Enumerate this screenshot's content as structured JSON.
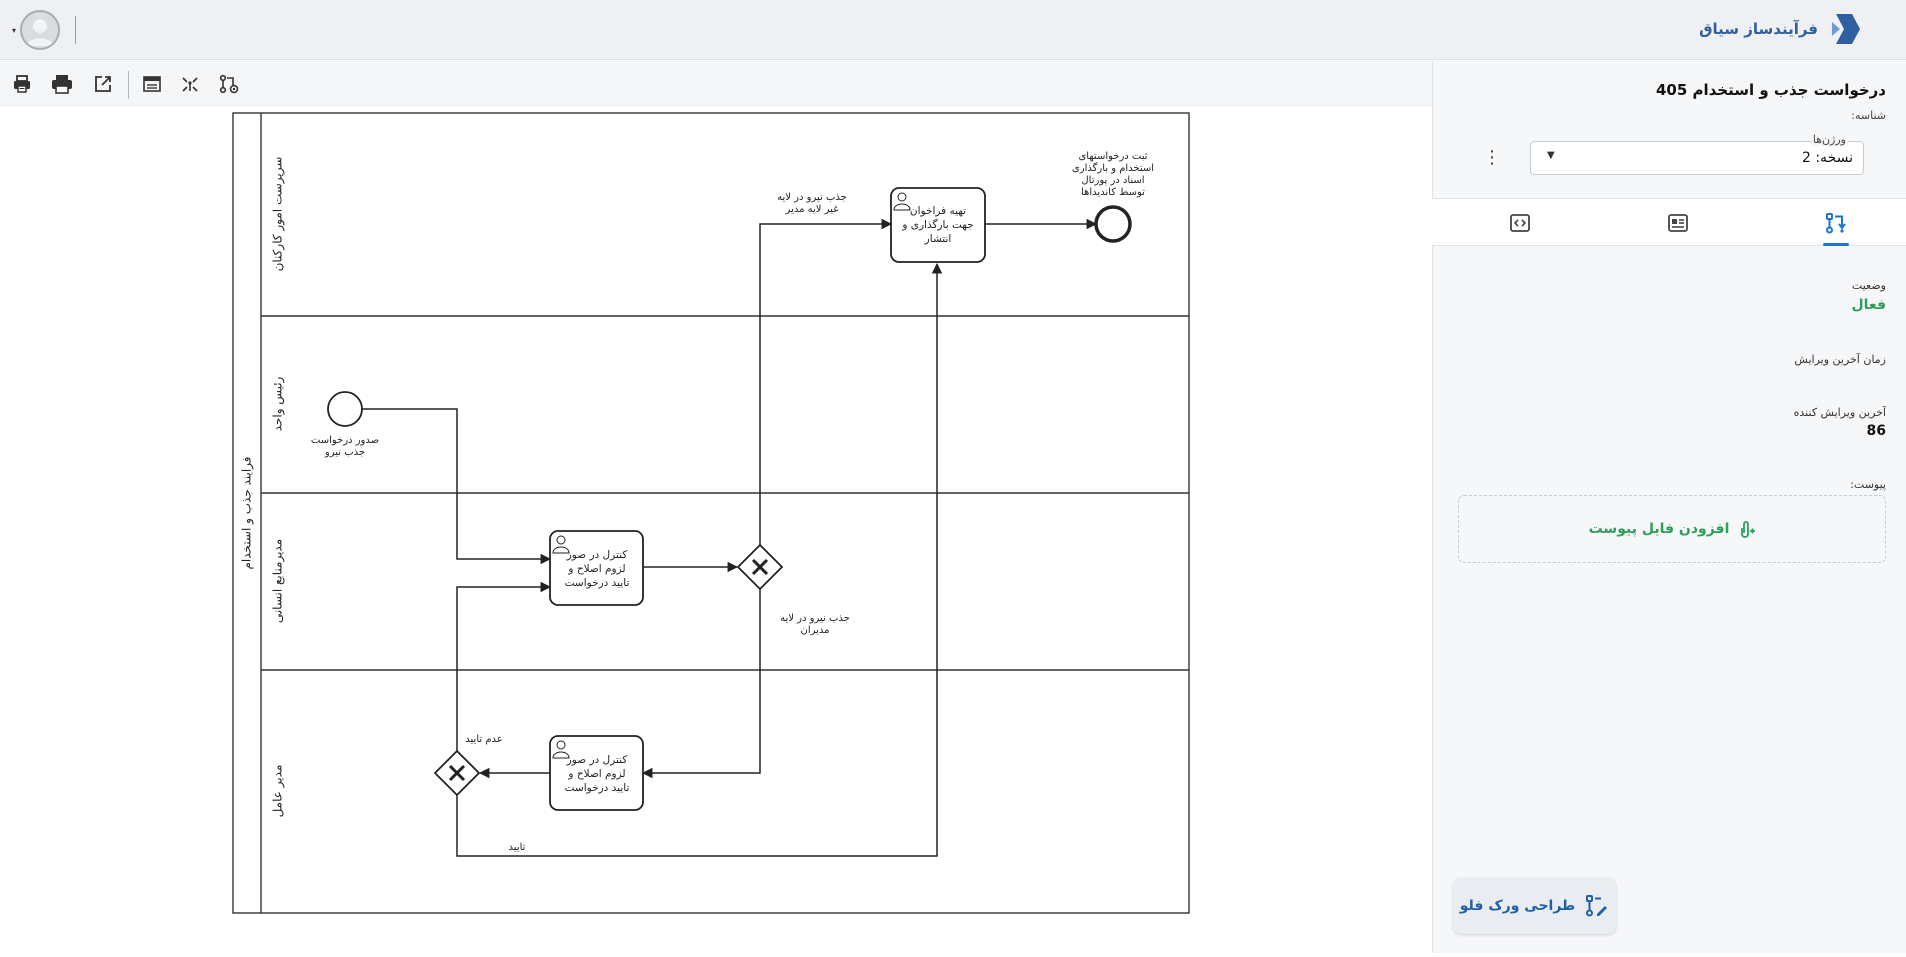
{
  "app": {
    "brand_name": "فرآیندساز سیاق",
    "brand_color": "#2f5f9e",
    "accent_color": "#1976d2",
    "active_color": "#2e9e5b"
  },
  "toolbar": {
    "icons": [
      "print-preview-icon",
      "print-icon",
      "open-external-icon",
      "table-view-icon",
      "split-icon",
      "process-settings-icon"
    ]
  },
  "panel": {
    "title": "درخواست جذب و استخدام 405",
    "id_label": "شناسه:",
    "versions_label": "ورژن‌ها",
    "version_value": "نسخه: 2",
    "tabs": [
      "diagram-flow-icon",
      "details-icon",
      "code-icon"
    ],
    "status_label": "وضعیت",
    "status_value": "فعال",
    "last_edit_time_label": "زمان آخرین ویرایش",
    "last_editor_label": "آخرین ویرایش کننده",
    "last_editor_value": "86",
    "attachment_label": "پیوست:",
    "add_attachment": "افزودن فایل پیوست",
    "design_workflow": "طراحی ورک فلو"
  },
  "diagram": {
    "pool_label": "فرایند جذب و استخدام",
    "lanes": [
      {
        "label": "سرپرست امور کارکنان"
      },
      {
        "label": "رئیس واحد"
      },
      {
        "label": "مدیرمنابع انسانی"
      },
      {
        "label": "مدیر عامل"
      }
    ],
    "start_event_label_l1": "صدور درخواست",
    "start_event_label_l2": "جذب نیرو",
    "end_event_label_l1": "ثبت درخواستهای",
    "end_event_label_l2": "استخدام و بارگذاری",
    "end_event_label_l3": "اسناد در پورتال",
    "end_event_label_l4": "توسط کاندیداها",
    "task_publish_l1": "تهیه فراخوان",
    "task_publish_l2": "جهت بارگذاری و",
    "task_publish_l3": "انتشار",
    "task_hr_l1": "کنترل در صور",
    "task_hr_l2": "لزوم اصلاح و",
    "task_hr_l3": "تایید درخواست",
    "task_ceo_l1": "کنترل در صور",
    "task_ceo_l2": "لزوم اصلاح و",
    "task_ceo_l3": "تایید درخواست",
    "flow_non_manager_l1": "جذب نیرو در لایه",
    "flow_non_manager_l2": "غیر لایه مدیر",
    "flow_manager_l1": "جذب نیرو در لایه",
    "flow_manager_l2": "مدیران",
    "flow_reject": "عدم تایید",
    "flow_approve": "تایید"
  }
}
